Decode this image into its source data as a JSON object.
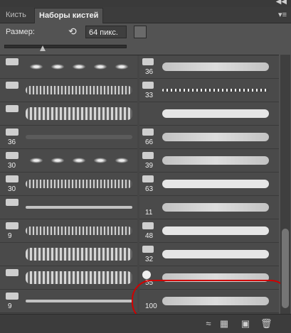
{
  "topbar": {
    "collapse_icon": "double-chevron-icon",
    "collapse_glyph": "◀◀"
  },
  "tabs": [
    {
      "label": "Кисть"
    },
    {
      "label": "Наборы кистей"
    }
  ],
  "menu_glyph": "▾≡",
  "size": {
    "label": "Размер:",
    "value": "64 пикс."
  },
  "left_numbers": [
    "",
    "",
    "",
    "36",
    "30",
    "30",
    "",
    "9",
    "",
    "",
    "9"
  ],
  "right_numbers": [
    "36",
    "33",
    "",
    "66",
    "39",
    "63",
    "11",
    "48",
    "32",
    "55",
    "100"
  ],
  "footer": {
    "icons": [
      "toggle-brush-panel-icon",
      "grid-icon",
      "new-preset-icon",
      "trash-icon"
    ],
    "glyphs": [
      "≈",
      "▦",
      "▣",
      "🗑"
    ]
  },
  "colors": {
    "highlight": "#d00000"
  }
}
